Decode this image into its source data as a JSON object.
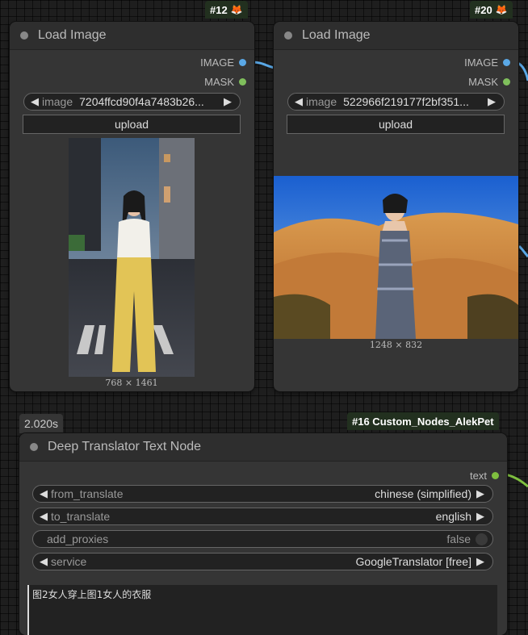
{
  "nodes": {
    "left": {
      "badge_id": "#12",
      "title": "Load Image",
      "outputs": [
        "IMAGE",
        "MASK"
      ],
      "image_label": "image",
      "image_value": "7204ffcd90f4a7483b26...",
      "upload_label": "upload",
      "dimensions": "768 × 1461"
    },
    "right": {
      "badge_id": "#20",
      "title": "Load Image",
      "outputs": [
        "IMAGE",
        "MASK"
      ],
      "image_label": "image",
      "image_value": "522966f219177f2bf351...",
      "upload_label": "upload",
      "dimensions": "1248 × 832"
    },
    "translator": {
      "timing": "2.020s",
      "badge": "#16 Custom_Nodes_AlekPet",
      "title": "Deep Translator Text Node",
      "output": "text",
      "from_label": "from_translate",
      "from_value": "chinese (simplified)",
      "to_label": "to_translate",
      "to_value": "english",
      "proxies_label": "add_proxies",
      "proxies_value": "false",
      "service_label": "service",
      "service_value": "GoogleTranslator [free]",
      "text_value": "图2女人穿上图1女人的衣服"
    }
  },
  "colors": {
    "image_socket": "#5aa8e6",
    "mask_socket": "#7fbf5c",
    "text_socket": "#7fbf3f",
    "badge_bg": "#22301f"
  },
  "icons": [
    "fox-icon",
    "left-arrow-icon",
    "right-arrow-icon",
    "status-dot-icon"
  ]
}
